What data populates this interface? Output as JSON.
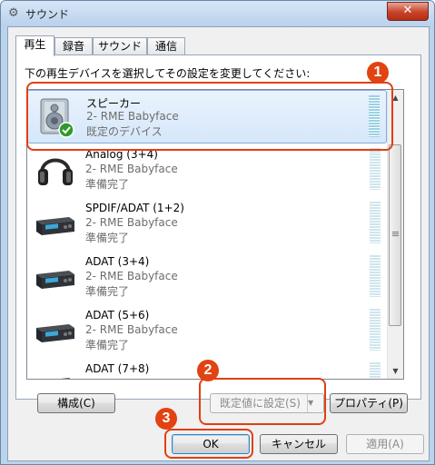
{
  "window": {
    "title": "サウンド",
    "close_label": "✕"
  },
  "tabs": [
    {
      "label": "再生"
    },
    {
      "label": "録音"
    },
    {
      "label": "サウンド"
    },
    {
      "label": "通信"
    }
  ],
  "instruction": "下の再生デバイスを選択してその設定を変更してください:",
  "devices": [
    {
      "name": "スピーカー",
      "driver": "2- RME Babyface",
      "status": "既定のデバイス",
      "icon": "speaker-icon"
    },
    {
      "name": "Analog (3+4)",
      "driver": "2- RME Babyface",
      "status": "準備完了",
      "icon": "headphones-icon"
    },
    {
      "name": "SPDIF/ADAT (1+2)",
      "driver": "2- RME Babyface",
      "status": "準備完了",
      "icon": "audio-device-icon"
    },
    {
      "name": "ADAT (3+4)",
      "driver": "2- RME Babyface",
      "status": "準備完了",
      "icon": "audio-device-icon"
    },
    {
      "name": "ADAT (5+6)",
      "driver": "2- RME Babyface",
      "status": "準備完了",
      "icon": "audio-device-icon"
    },
    {
      "name": "ADAT (7+8)",
      "driver": "",
      "status": "",
      "icon": "audio-device-icon"
    }
  ],
  "buttons": {
    "configure": "構成(C)",
    "set_default": "既定値に設定(S)",
    "properties": "プロパティ(P)",
    "ok": "OK",
    "cancel": "キャンセル",
    "apply": "適用(A)"
  },
  "annotations": [
    {
      "number": "1"
    },
    {
      "number": "2"
    },
    {
      "number": "3"
    }
  ],
  "colors": {
    "annotation": "#e14312",
    "selection": "#d5e7fa",
    "check": "#2e9a2e"
  }
}
